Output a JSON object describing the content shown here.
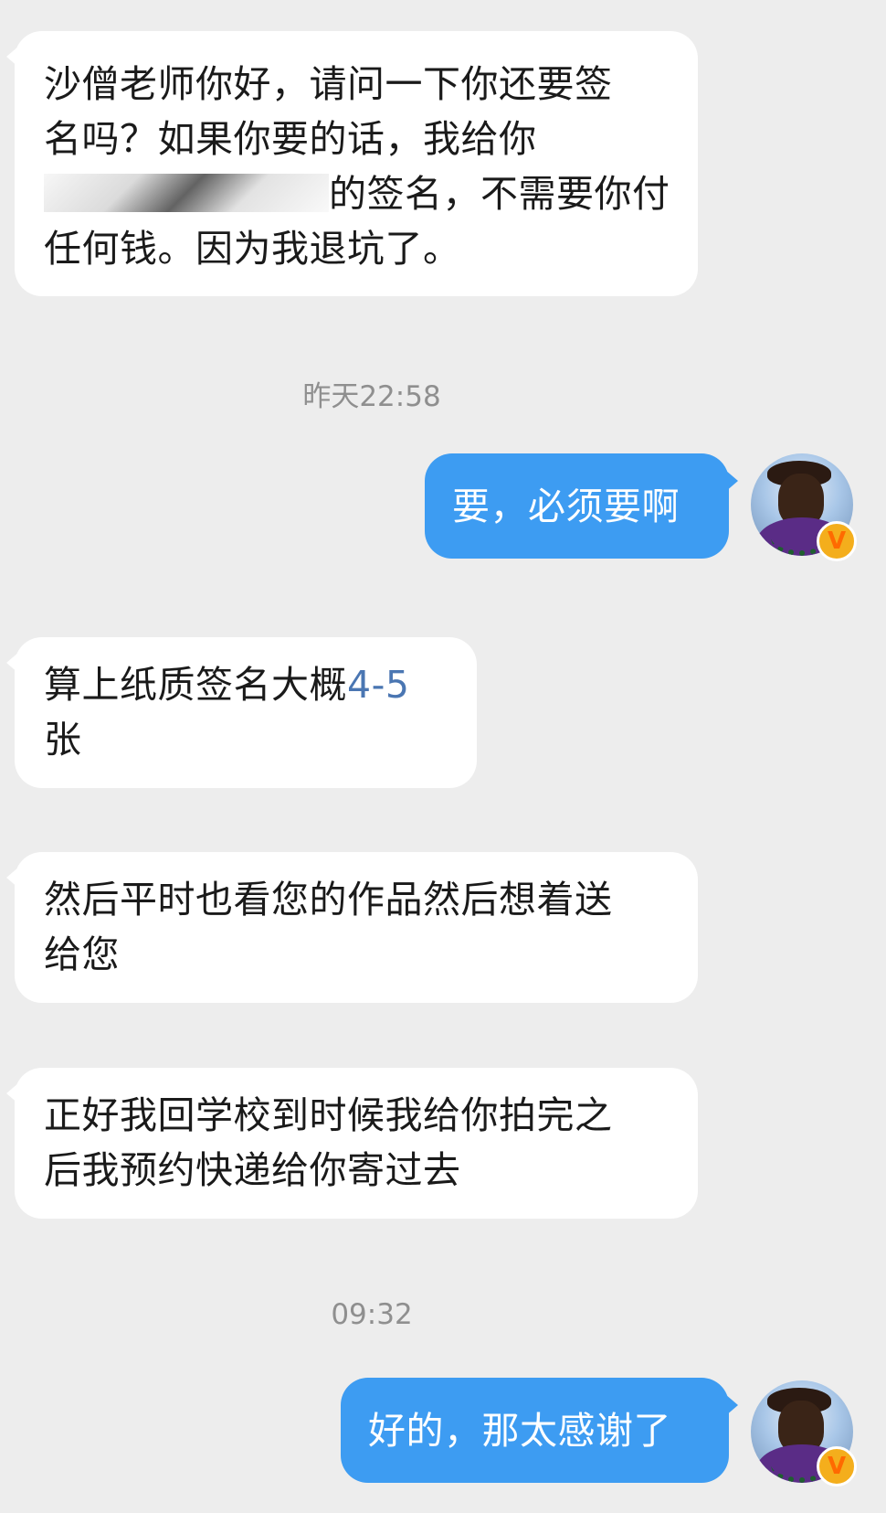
{
  "messages": [
    {
      "role": "incoming",
      "text_line_1": "沙僧老师你好，请问一下你还要签",
      "text_line_2": "名吗？如果你要的话，我给你",
      "text_line_3_suffix": "的签名，不需要你付",
      "text_line_4": "任何钱。因为我退坑了。"
    },
    {
      "role": "timestamp",
      "text": "昨天22:58"
    },
    {
      "role": "outgoing",
      "text": "要，必须要啊"
    },
    {
      "role": "incoming",
      "text_prefix": "算上纸质签名大概",
      "text_link": "4-5",
      "text_line_2": "张"
    },
    {
      "role": "incoming",
      "text_line_1": "然后平时也看您的作品然后想着送",
      "text_line_2": "给您"
    },
    {
      "role": "incoming",
      "text_line_1": "正好我回学校到时候我给你拍完之",
      "text_line_2": "后我预约快递给你寄过去"
    },
    {
      "role": "timestamp",
      "text": "09:32"
    },
    {
      "role": "outgoing",
      "text": "好的，那太感谢了"
    }
  ],
  "avatar": {
    "badge": "V",
    "badge_color": "#f4ae1c"
  },
  "colors": {
    "background": "#ededed",
    "incoming_bubble": "#ffffff",
    "outgoing_bubble": "#3d9cf2",
    "link": "#4a76b2",
    "timestamp": "#8f8f8f"
  }
}
